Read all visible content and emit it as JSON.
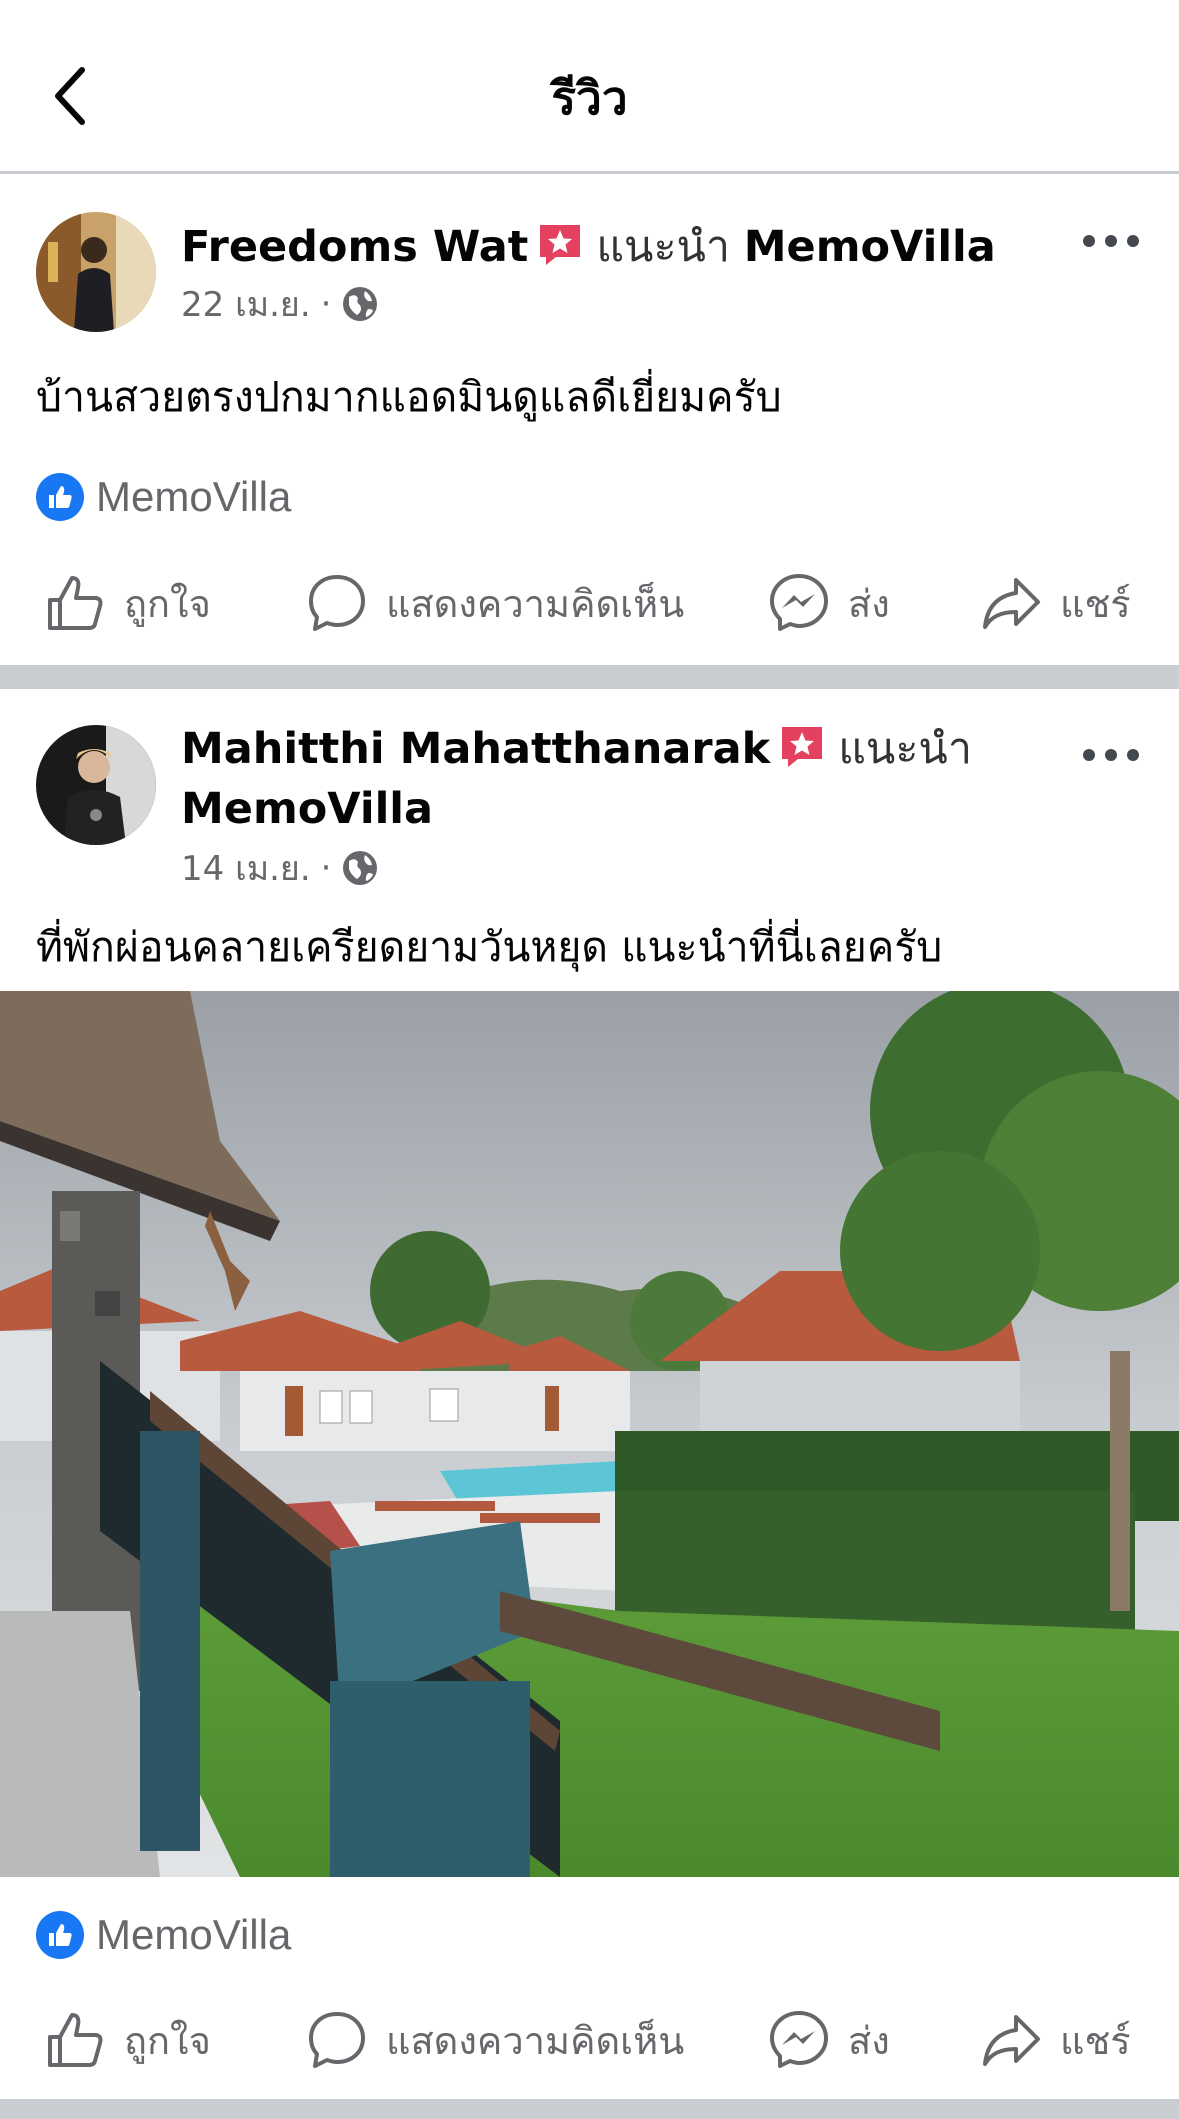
{
  "header": {
    "title": "รีวิว"
  },
  "posts": [
    {
      "author": "Freedoms Wat",
      "recommend_text": "แนะนำ",
      "page": "MemoVilla",
      "date": "22 เม.ย.",
      "separator": "·",
      "text": "บ้านสวยตรงปกมากแอดมินดูแลดีเยี่ยมครับ",
      "reactor": "MemoVilla",
      "actions": {
        "like": "ถูกใจ",
        "comment": "แสดงความคิดเห็น",
        "send": "ส่ง",
        "share": "แชร์"
      }
    },
    {
      "author": "Mahitthi Mahatthanarak",
      "recommend_text": "แนะนำ",
      "page": "MemoVilla",
      "date": "14 เม.ย.",
      "separator": "·",
      "text": "ที่พักผ่อนคลายเครียดยามวันหยุด แนะนำที่นี่เลยครับ",
      "reactor": "MemoVilla",
      "actions": {
        "like": "ถูกใจ",
        "comment": "แสดงความคิดเห็น",
        "send": "ส่ง",
        "share": "แชร์"
      }
    }
  ],
  "colors": {
    "accent": "#1877f2",
    "badge": "#e4405f",
    "secondary_text": "#65676b",
    "divider": "#c9ccd1"
  }
}
